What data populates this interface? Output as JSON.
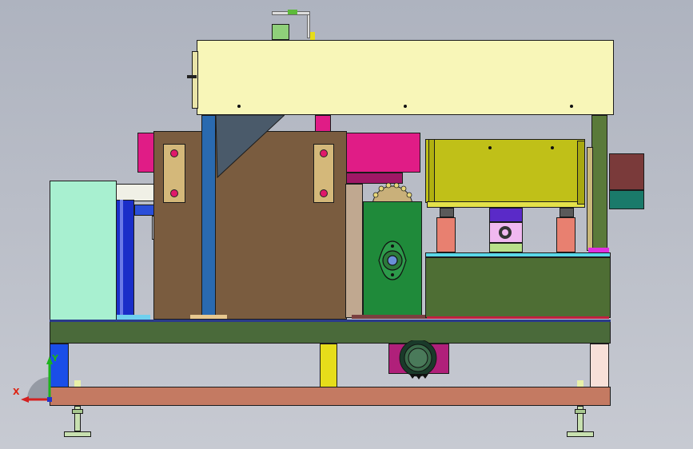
{
  "view": {
    "background_top": "#aeb3bf",
    "background_bottom": "#c7cad2"
  },
  "triad": {
    "x_axis_label": "X",
    "y_axis_label": "Y",
    "x_color": "#d42020",
    "y_color": "#1db31d",
    "z_color": "#2233cc"
  },
  "parts": {
    "top_cover": {
      "color": "#f8f6b8"
    },
    "base_frame": {
      "color": "#4a6a3a"
    },
    "lower_rail": {
      "color": "#c47a62"
    },
    "main_housing": {
      "color": "#7a5c3f"
    },
    "magenta_guide": {
      "color": "#e01c86"
    },
    "yellow_tray": {
      "color": "#c0c018"
    },
    "green_cabinet": {
      "color": "#a8f0d0"
    },
    "gear_housing": {
      "color": "#1f8a3a"
    },
    "right_block": {
      "color": "#4e6e34"
    },
    "brown_box": {
      "color": "#7a3a3a"
    },
    "teal_box": {
      "color": "#1a7a6a"
    }
  }
}
